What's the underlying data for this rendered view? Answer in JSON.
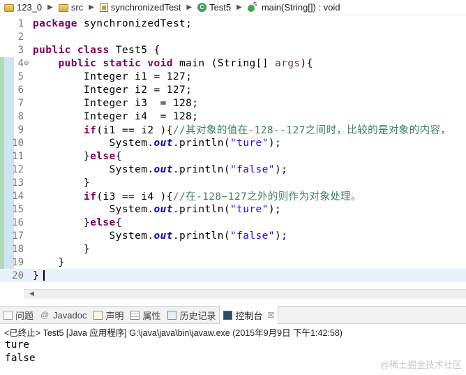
{
  "breadcrumb": {
    "items": [
      {
        "label": "123_0",
        "icon": "project-icon"
      },
      {
        "label": "src",
        "icon": "source-folder-icon"
      },
      {
        "label": "synchronizedTest",
        "icon": "package-icon"
      },
      {
        "label": "Test5",
        "icon": "class-icon"
      },
      {
        "label": "main(String[]) : void",
        "icon": "method-icon"
      }
    ]
  },
  "editor": {
    "lines": [
      {
        "n": "1",
        "tokens": [
          {
            "t": "kw",
            "v": "package"
          },
          {
            "t": "",
            "v": " synchronizedTest;"
          }
        ]
      },
      {
        "n": "2",
        "tokens": []
      },
      {
        "n": "3",
        "tokens": [
          {
            "t": "kw",
            "v": "public"
          },
          {
            "t": "",
            "v": " "
          },
          {
            "t": "kw",
            "v": "class"
          },
          {
            "t": "",
            "v": " Test5 {"
          }
        ]
      },
      {
        "n": "4",
        "tokens": [
          {
            "t": "",
            "v": "    "
          },
          {
            "t": "kw",
            "v": "public"
          },
          {
            "t": "",
            "v": " "
          },
          {
            "t": "kw",
            "v": "static"
          },
          {
            "t": "",
            "v": " "
          },
          {
            "t": "kw",
            "v": "void"
          },
          {
            "t": "",
            "v": " main (String[] "
          },
          {
            "t": "param",
            "v": "args"
          },
          {
            "t": "",
            "v": "){"
          }
        ]
      },
      {
        "n": "5",
        "tokens": [
          {
            "t": "",
            "v": "        Integer i1 = 127;"
          }
        ]
      },
      {
        "n": "6",
        "tokens": [
          {
            "t": "",
            "v": "        Integer i2 = 127;"
          }
        ]
      },
      {
        "n": "7",
        "tokens": [
          {
            "t": "",
            "v": "        Integer i3  = 128;"
          }
        ]
      },
      {
        "n": "8",
        "tokens": [
          {
            "t": "",
            "v": "        Integer i4  = 128;"
          }
        ]
      },
      {
        "n": "9",
        "tokens": [
          {
            "t": "",
            "v": "        "
          },
          {
            "t": "kw",
            "v": "if"
          },
          {
            "t": "",
            "v": "(i1 == i2 ){"
          },
          {
            "t": "cmt",
            "v": "//其对象的值在-128--127之间时，比较的是对象的内容，"
          }
        ]
      },
      {
        "n": "10",
        "tokens": [
          {
            "t": "",
            "v": "            System."
          },
          {
            "t": "fld",
            "v": "out"
          },
          {
            "t": "",
            "v": ".println("
          },
          {
            "t": "str",
            "v": "\"ture\""
          },
          {
            "t": "",
            "v": ");"
          }
        ]
      },
      {
        "n": "11",
        "tokens": [
          {
            "t": "",
            "v": "        }"
          },
          {
            "t": "kw",
            "v": "else"
          },
          {
            "t": "",
            "v": "{"
          }
        ]
      },
      {
        "n": "12",
        "tokens": [
          {
            "t": "",
            "v": "            System."
          },
          {
            "t": "fld",
            "v": "out"
          },
          {
            "t": "",
            "v": ".println("
          },
          {
            "t": "str",
            "v": "\"false\""
          },
          {
            "t": "",
            "v": ");"
          }
        ]
      },
      {
        "n": "13",
        "tokens": [
          {
            "t": "",
            "v": "        }"
          }
        ]
      },
      {
        "n": "14",
        "tokens": [
          {
            "t": "",
            "v": "        "
          },
          {
            "t": "kw",
            "v": "if"
          },
          {
            "t": "",
            "v": "(i3 == i4 ){"
          },
          {
            "t": "cmt",
            "v": "//在-128~127之外的则作为对象处理。"
          }
        ]
      },
      {
        "n": "15",
        "tokens": [
          {
            "t": "",
            "v": "            System."
          },
          {
            "t": "fld",
            "v": "out"
          },
          {
            "t": "",
            "v": ".println("
          },
          {
            "t": "str",
            "v": "\"ture\""
          },
          {
            "t": "",
            "v": ");"
          }
        ]
      },
      {
        "n": "16",
        "tokens": [
          {
            "t": "",
            "v": "        }"
          },
          {
            "t": "kw",
            "v": "else"
          },
          {
            "t": "",
            "v": "{"
          }
        ]
      },
      {
        "n": "17",
        "tokens": [
          {
            "t": "",
            "v": "            System."
          },
          {
            "t": "fld",
            "v": "out"
          },
          {
            "t": "",
            "v": ".println("
          },
          {
            "t": "str",
            "v": "\"false\""
          },
          {
            "t": "",
            "v": ");"
          }
        ]
      },
      {
        "n": "18",
        "tokens": [
          {
            "t": "",
            "v": "        }"
          }
        ]
      },
      {
        "n": "19",
        "tokens": [
          {
            "t": "",
            "v": "    }"
          }
        ]
      },
      {
        "n": "20",
        "tokens": [
          {
            "t": "",
            "v": "}"
          }
        ]
      }
    ],
    "current_line": "20"
  },
  "views": {
    "tabs": [
      {
        "label": "问题",
        "icon": "problems-icon",
        "active": false
      },
      {
        "label": "Javadoc",
        "icon": "javadoc-icon",
        "active": false
      },
      {
        "label": "声明",
        "icon": "declaration-icon",
        "active": false
      },
      {
        "label": "属性",
        "icon": "properties-icon",
        "active": false
      },
      {
        "label": "历史记录",
        "icon": "history-icon",
        "active": false
      },
      {
        "label": "控制台",
        "icon": "console-icon",
        "active": true
      }
    ]
  },
  "console": {
    "status": "<已终止> Test5 [Java 应用程序] G:\\java\\java\\bin\\javaw.exe (2015年9月9日 下午1:42:58)",
    "output": [
      "ture",
      "false"
    ]
  },
  "watermark": "@稀土掘金技术社区"
}
